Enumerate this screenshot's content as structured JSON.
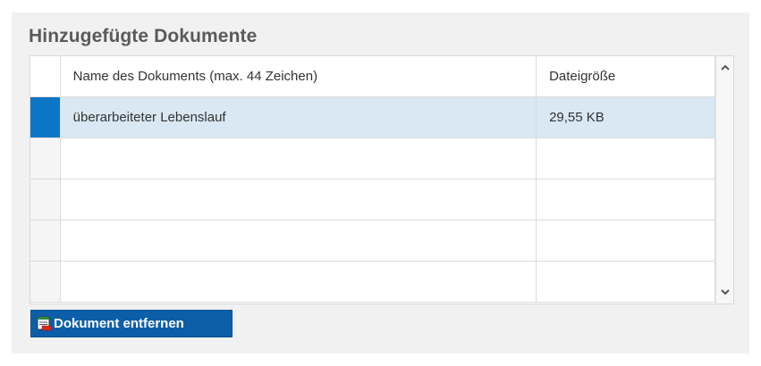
{
  "panel": {
    "title": "Hinzugefügte Dokumente"
  },
  "table": {
    "columns": {
      "name": "Name des Dokuments (max. 44 Zeichen)",
      "size": "Dateigröße"
    },
    "rows": [
      {
        "name": "überarbeiteter Lebenslauf",
        "size": "29,55 KB",
        "selected": true
      },
      {
        "name": "",
        "size": "",
        "selected": false
      },
      {
        "name": "",
        "size": "",
        "selected": false
      },
      {
        "name": "",
        "size": "",
        "selected": false
      },
      {
        "name": "",
        "size": "",
        "selected": false
      }
    ]
  },
  "icons": {
    "scroll_up": "chevron-up-icon",
    "scroll_down": "chevron-down-icon",
    "remove": "document-remove-icon"
  },
  "colors": {
    "selected_row": "#d9e8f3",
    "selected_marker": "#0b76c6",
    "button_bg": "#0c5ea8"
  },
  "actions": {
    "remove_label": "Dokument entfernen"
  }
}
